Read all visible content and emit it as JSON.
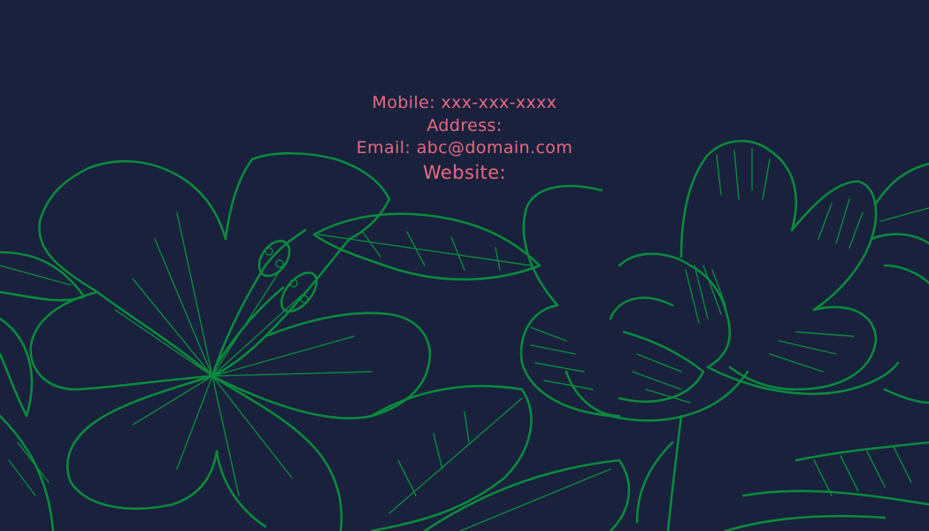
{
  "contact": {
    "mobile": "Mobile: xxx-xxx-xxxx",
    "address": "Address:",
    "email": "Email: abc@domain.com",
    "website": "Website:"
  },
  "colors": {
    "background": "#19213d",
    "text_accent": "#e9697f",
    "line_art": "#0a8a3c"
  },
  "illustrations": {
    "left": "hibiscus-flower-line-art",
    "right": "magnolia-flower-line-art"
  }
}
